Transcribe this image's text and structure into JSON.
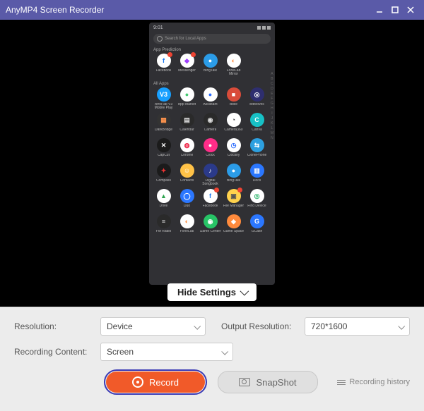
{
  "title": "AnyMP4 Screen Recorder",
  "hide_settings_label": "Hide Settings",
  "phone": {
    "time": "9:01",
    "search_placeholder": "Search for Local Apps",
    "section_prediction": "App Prediction",
    "section_all": "All Apps",
    "index_letters": "A\nB\nC\nD\nE\nF\nG\nH\nI\nJ\nK\nL\nM\nN",
    "prediction": [
      {
        "name": "Facebook",
        "glyph": "f",
        "bg": "#ffffff",
        "fg": "#1877f2",
        "badge": true
      },
      {
        "name": "Messenger",
        "glyph": "◆",
        "bg": "#ffffff",
        "fg": "#a040ff",
        "badge": true
      },
      {
        "name": "BingTalk",
        "glyph": "●",
        "bg": "#2b9ce8",
        "fg": "#fff",
        "badge": false
      },
      {
        "name": "FoneLab Mirror",
        "glyph": "◐",
        "bg": "#ffffff",
        "fg": "#ff8a3c",
        "badge": false
      }
    ],
    "apps": [
      {
        "name": "AfroFab V3 Mobile Play",
        "glyph": "V3",
        "bg": "#18a0ff",
        "fg": "#fff"
      },
      {
        "name": "App Market",
        "glyph": "●",
        "bg": "#ffffff",
        "fg": "#45c971"
      },
      {
        "name": "Assistant",
        "glyph": "●",
        "bg": "#ffffff",
        "fg": "#2b6cff"
      },
      {
        "name": "Bible",
        "glyph": "■",
        "bg": "#d94c3a",
        "fg": "#fff"
      },
      {
        "name": "BitMoves",
        "glyph": "◎",
        "bg": "#2e2e6f",
        "fg": "#fff"
      },
      {
        "name": "DarkBridge",
        "glyph": "▦",
        "bg": "#333",
        "fg": "#ff944d"
      },
      {
        "name": "Calendar",
        "glyph": "▤",
        "bg": "#2a2a2a",
        "fg": "#ddd"
      },
      {
        "name": "Camera",
        "glyph": "◉",
        "bg": "#2a2a2a",
        "fg": "#ddd"
      },
      {
        "name": "Camera360",
        "glyph": "◔",
        "bg": "#ffffff",
        "fg": "#333"
      },
      {
        "name": "Canva",
        "glyph": "C",
        "bg": "#17c1c6",
        "fg": "#fff"
      },
      {
        "name": "CapCut",
        "glyph": "✕",
        "bg": "#1b1b1b",
        "fg": "#fff"
      },
      {
        "name": "Chrome",
        "glyph": "◍",
        "bg": "#ffffff",
        "fg": "#e24"
      },
      {
        "name": "Clock",
        "glyph": "●",
        "bg": "#ff2d88",
        "fg": "#fff"
      },
      {
        "name": "Clockify",
        "glyph": "◷",
        "bg": "#ffffff",
        "fg": "#2b6cff"
      },
      {
        "name": "ClonePhone",
        "glyph": "⇆",
        "bg": "#2da0e0",
        "fg": "#fff"
      },
      {
        "name": "Compass",
        "glyph": "✦",
        "bg": "#1b1b1b",
        "fg": "#e33"
      },
      {
        "name": "Contacts",
        "glyph": "☺",
        "bg": "#ffc247",
        "fg": "#fff"
      },
      {
        "name": "Digital Songbook",
        "glyph": "♪",
        "bg": "#2b3a8a",
        "fg": "#fff"
      },
      {
        "name": "BingTalk",
        "glyph": "●",
        "bg": "#2b9ce8",
        "fg": "#fff"
      },
      {
        "name": "Docs",
        "glyph": "▥",
        "bg": "#2b77ff",
        "fg": "#fff"
      },
      {
        "name": "Drive",
        "glyph": "▲",
        "bg": "#ffffff",
        "fg": "#2da44e"
      },
      {
        "name": "Duo",
        "glyph": "◯",
        "bg": "#2b77ff",
        "fg": "#fff"
      },
      {
        "name": "Facebook",
        "glyph": "f",
        "bg": "#ffffff",
        "fg": "#1877f2",
        "badge": true
      },
      {
        "name": "File Manager",
        "glyph": "▣",
        "bg": "#ffd24d",
        "fg": "#555",
        "badge": true
      },
      {
        "name": "Find Device",
        "glyph": "◎",
        "bg": "#ffffff",
        "fg": "#2bb56a"
      },
      {
        "name": "FM Radio",
        "glyph": "≡",
        "bg": "#2a2a2a",
        "fg": "#ccc"
      },
      {
        "name": "FoneLab",
        "glyph": "◐",
        "bg": "#ffffff",
        "fg": "#ff8a3c"
      },
      {
        "name": "Game Center",
        "glyph": "◉",
        "bg": "#27c466",
        "fg": "#fff"
      },
      {
        "name": "Game Space",
        "glyph": "◆",
        "bg": "#ff8a3c",
        "fg": "#fff"
      },
      {
        "name": "GCash",
        "glyph": "G",
        "bg": "#2b77ff",
        "fg": "#fff"
      }
    ]
  },
  "settings": {
    "resolution_label": "Resolution:",
    "resolution_value": "Device",
    "output_label": "Output Resolution:",
    "output_value": "720*1600",
    "content_label": "Recording Content:",
    "content_value": "Screen"
  },
  "buttons": {
    "record": "Record",
    "snapshot": "SnapShot",
    "history": "Recording history"
  }
}
